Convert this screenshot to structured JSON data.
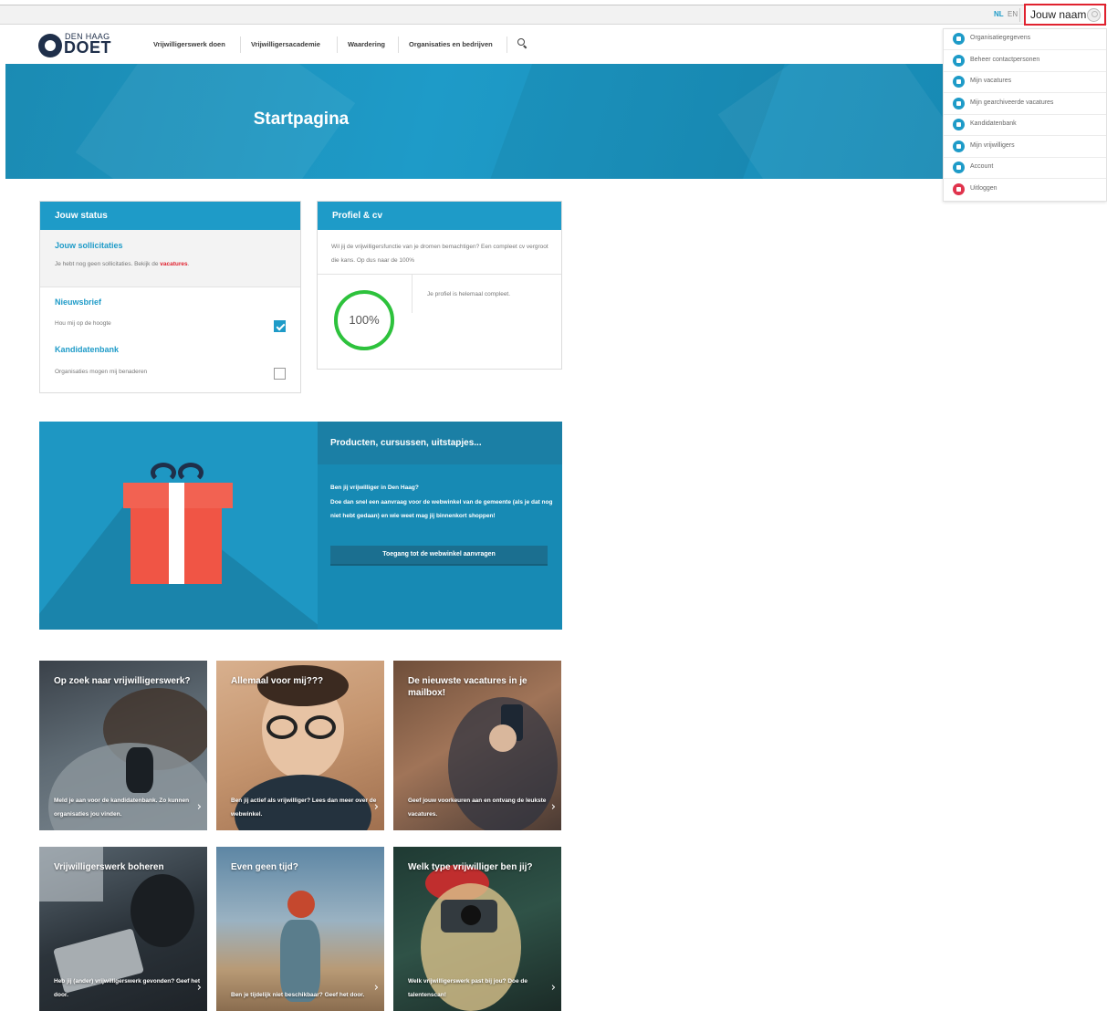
{
  "topbar": {
    "lang_nl": "NL",
    "lang_en": "EN",
    "user_name": "Jouw naam"
  },
  "user_menu": {
    "items": [
      {
        "label": "Organisatiegegevens",
        "icon": "building-icon"
      },
      {
        "label": "Beheer contactpersonen",
        "icon": "contacts-icon"
      },
      {
        "label": "Mijn vacatures",
        "icon": "list-icon"
      },
      {
        "label": "Mijn gearchiveerde vacatures",
        "icon": "archive-icon"
      },
      {
        "label": "Kandidatenbank",
        "icon": "database-icon"
      },
      {
        "label": "Mijn vrijwilligers",
        "icon": "bookmark-icon"
      },
      {
        "label": "Account",
        "icon": "gear-icon"
      },
      {
        "label": "Uitloggen",
        "icon": "logout-icon"
      }
    ]
  },
  "header": {
    "logo_small": "DEN HAAG",
    "logo_big": "DOET",
    "nav": [
      "Vrijwilligerswerk doen",
      "Vrijwilligersacademie",
      "Waardering",
      "Organisaties en bedrijven"
    ]
  },
  "hero": {
    "title": "Startpagina"
  },
  "status_card": {
    "title": "Jouw status",
    "applications_title": "Jouw sollicitaties",
    "applications_text": "Je hebt nog geen sollicitaties. Bekijk de",
    "applications_link": "vacatures",
    "applications_end": ".",
    "newsletter_title": "Nieuwsbrief",
    "newsletter_text": "Hou mij op de hoogte",
    "newsletter_checked": true,
    "candidates_title": "Kandidatenbank",
    "candidates_text": "Organisaties mogen mij benaderen",
    "candidates_checked": false
  },
  "profile_card": {
    "title": "Profiel & cv",
    "intro": "Wil jij de vrijwilligersfunctie van je dromen bemachtigen? Een compleet cv vergroot die kans. Op dus naar de 100%",
    "progress_label": "100%",
    "progress_value": 1.0,
    "status_text": "Je profiel is helemaal compleet."
  },
  "promo": {
    "title": "Producten, cursussen, uitstapjes...",
    "body_line1": "Ben jij vrijwilliger in Den Haag?",
    "body_line2": "Doe dan snel een aanvraag voor de webwinkel van de gemeente (als je dat nog niet hebt gedaan) en wie weet mag jij binnenkort shoppen!",
    "button": "Toegang tot de webwinkel aanvragen"
  },
  "tiles": [
    {
      "title": "Op zoek naar vrijwilligerswerk?",
      "caption": "Meld je aan voor de kandidatenbank. Zo kunnen organisaties jou vinden."
    },
    {
      "title": "Allemaal voor mij???",
      "caption": "Ben jij actief als vrijwilliger? Lees dan meer over de webwinkel."
    },
    {
      "title": "De nieuwste vacatures in je mailbox!",
      "caption": "Geef jouw voorkeuren aan en ontvang de leukste vacatures."
    },
    {
      "title": "Vrijwilligerswerk boheren",
      "caption": "Heb jij (ander) vrijwilligerswerk gevonden? Geef het door."
    },
    {
      "title": "Even geen tijd?",
      "caption": "Ben je tijdelijk niet beschikbaar? Geef het door."
    },
    {
      "title": "Welk type vrijwilliger ben jij?",
      "caption": "Welk vrijwilligerswerk past bij jou? Doe de talentenscan!"
    }
  ],
  "colors": {
    "brand_blue": "#1e9bc8",
    "brand_navy": "#1f2f4a",
    "accent_red": "#e0222f",
    "progress_green": "#2dc23c"
  }
}
